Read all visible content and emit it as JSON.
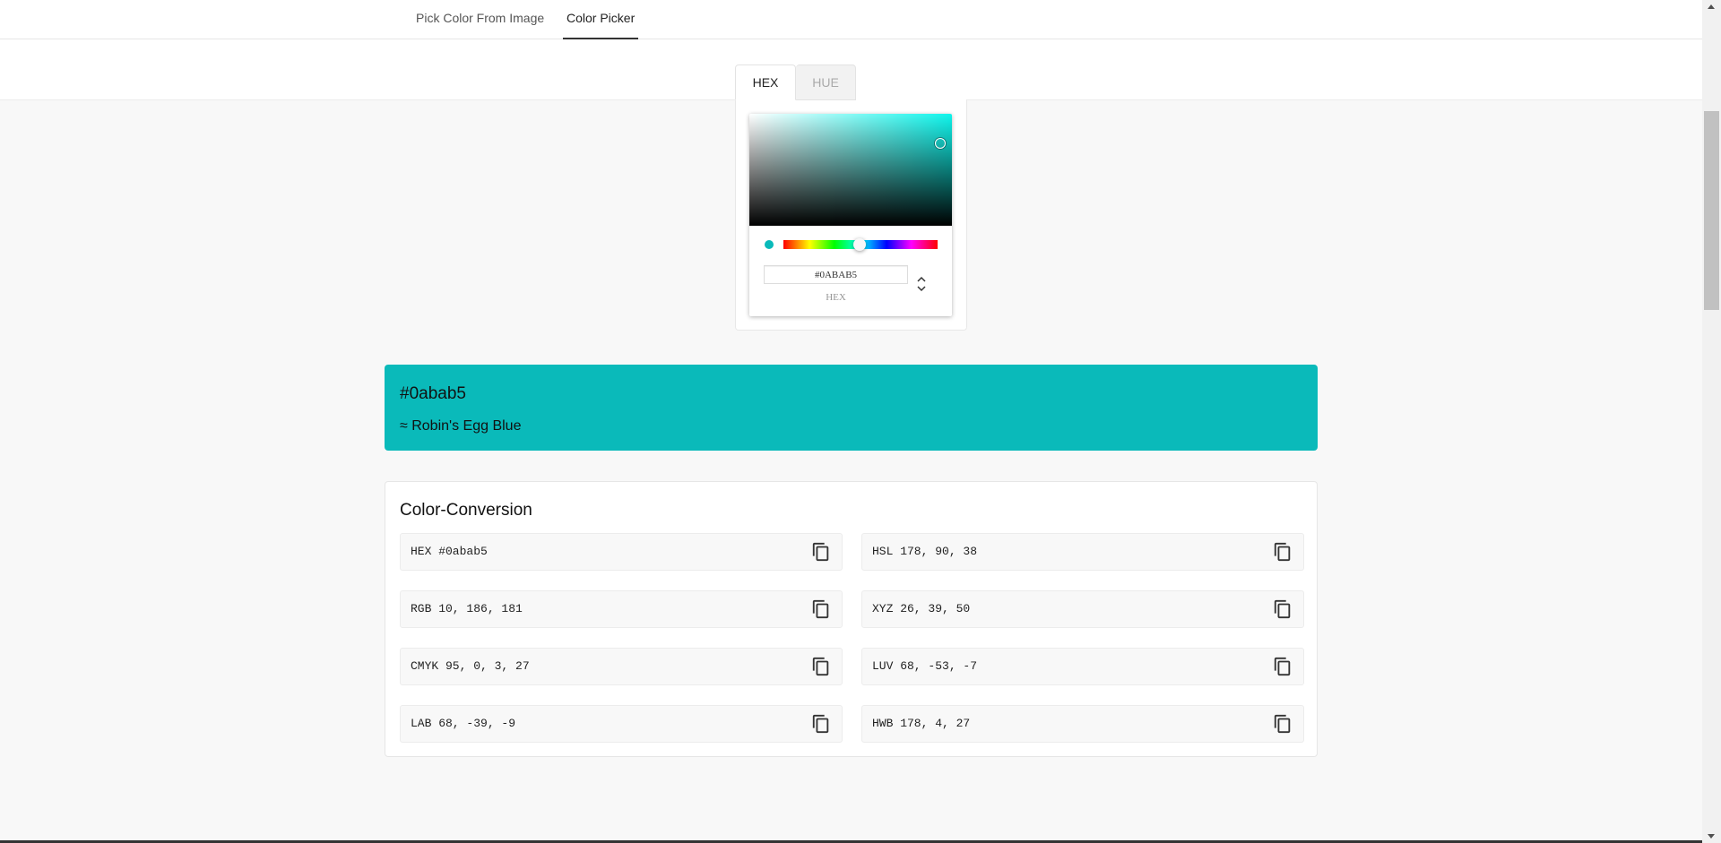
{
  "nav": {
    "tabs": [
      {
        "label": "Pick Color From Image",
        "active": false
      },
      {
        "label": "Color Picker",
        "active": true
      }
    ]
  },
  "picker": {
    "tabs": [
      {
        "label": "HEX",
        "active": true
      },
      {
        "label": "HUE",
        "active": false
      }
    ],
    "hex_value": "#0ABAB5",
    "input_label": "HEX",
    "hue_degrees": 178,
    "base_hue_color": "#0ff5ec",
    "swatch_color": "#0ababa"
  },
  "selected": {
    "hex": "#0abab5",
    "name": "≈ Robin's Egg Blue",
    "background": "#0ababa"
  },
  "conversion": {
    "title": "Color-Conversion",
    "rows": [
      {
        "text": "HEX #0abab5"
      },
      {
        "text": "HSL 178, 90, 38"
      },
      {
        "text": "RGB 10, 186, 181"
      },
      {
        "text": "XYZ 26, 39, 50"
      },
      {
        "text": "CMYK 95, 0, 3, 27"
      },
      {
        "text": "LUV 68, -53, -7"
      },
      {
        "text": "LAB 68, -39, -9"
      },
      {
        "text": "HWB 178, 4, 27"
      }
    ]
  },
  "icons": {
    "copy": "copy-icon",
    "toggle": "chevron-up-down-icon"
  }
}
